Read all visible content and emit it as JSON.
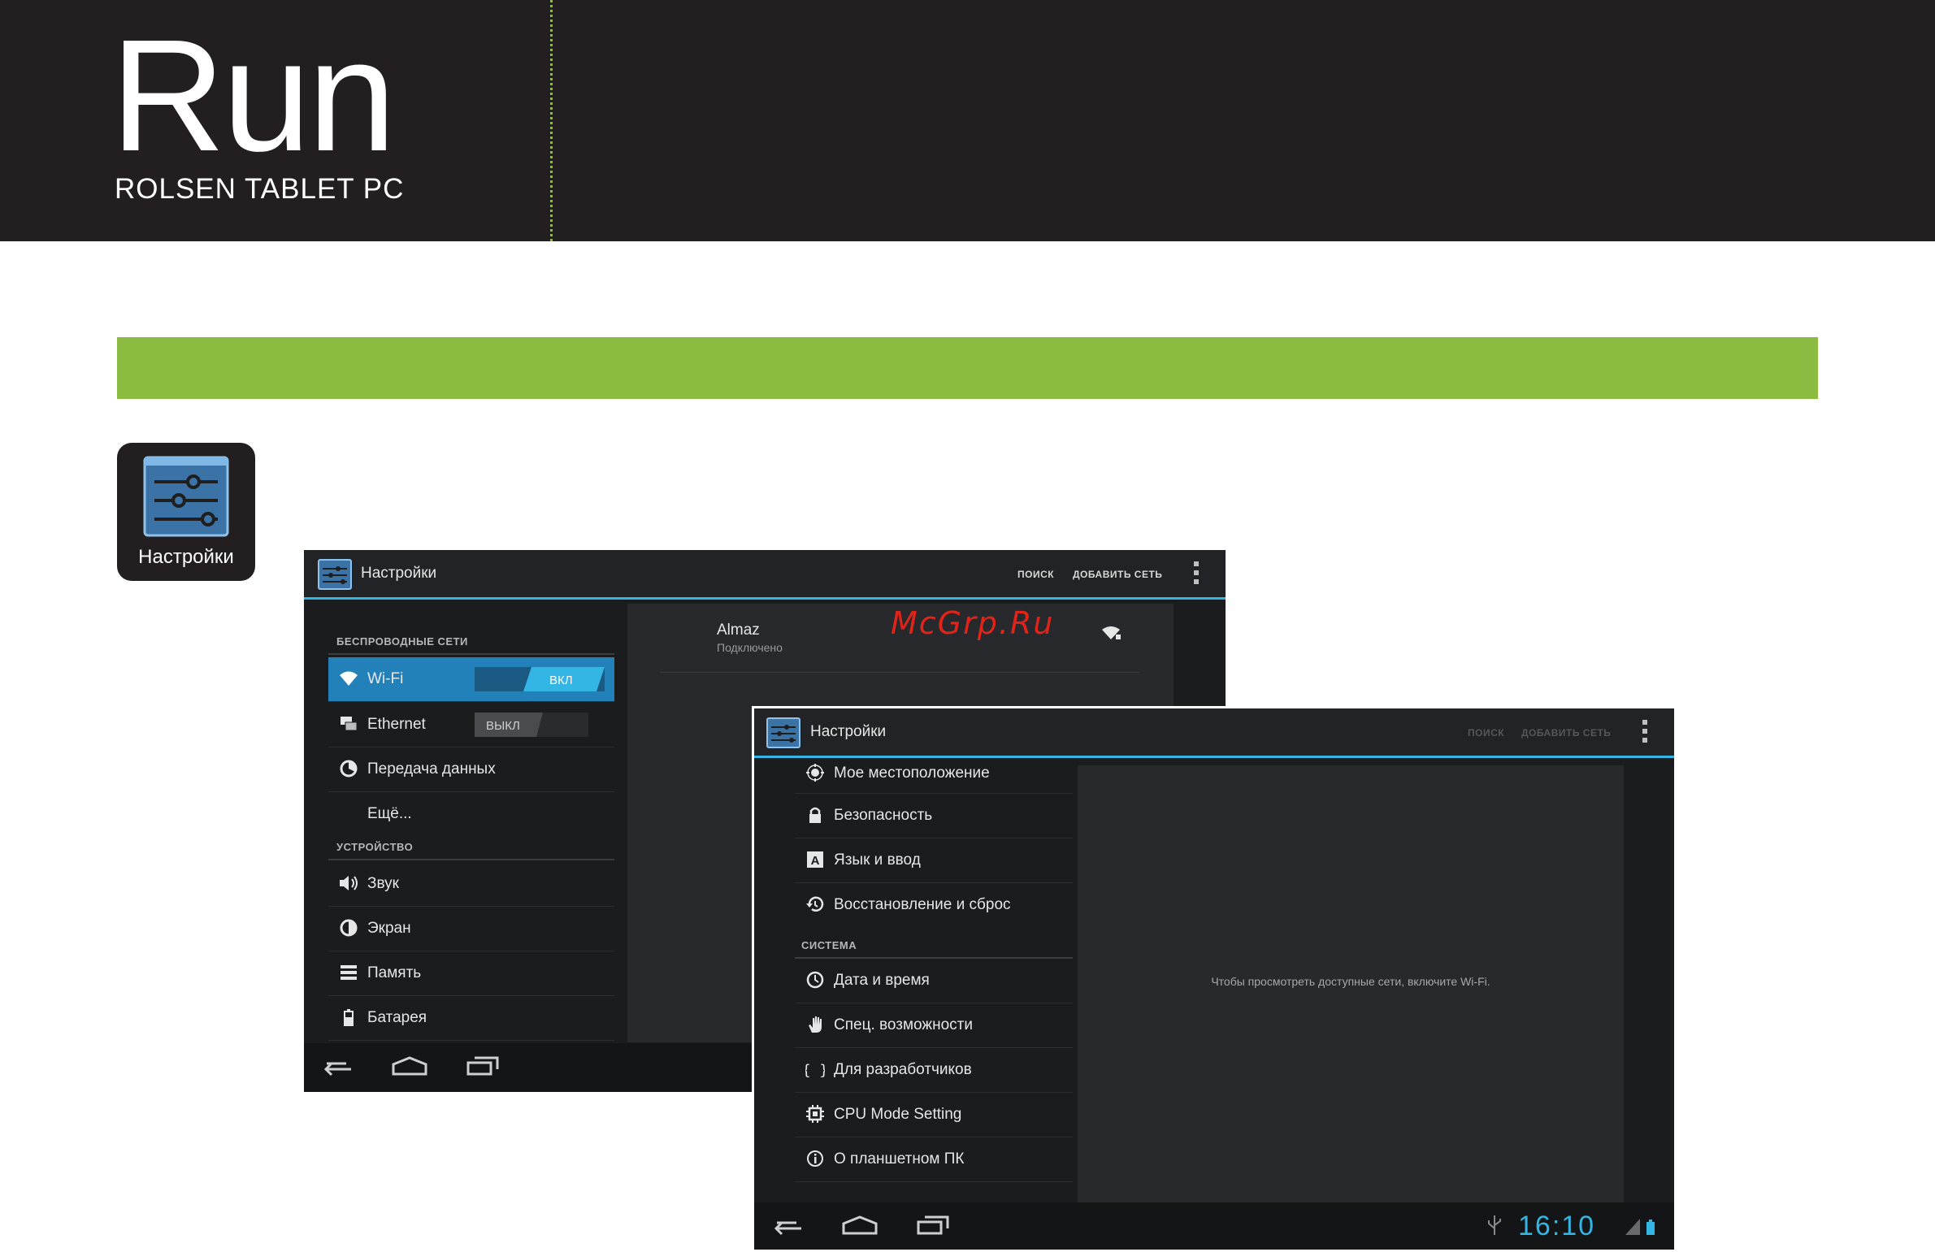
{
  "header": {
    "brand": "Run",
    "subtitle": "ROLSEN TABLET PC"
  },
  "app_icon": {
    "label": "Настройки",
    "icon": "settings-sliders-icon"
  },
  "screen1": {
    "title": "Настройки",
    "actions": [
      "ПОИСК",
      "ДОБАВИТЬ СЕТЬ"
    ],
    "sections": [
      "БЕСПРОВОДНЫЕ СЕТИ",
      "УСТРОЙСТВО"
    ],
    "items": [
      {
        "label": "Wi-Fi",
        "icon": "wifi-icon",
        "toggle": "ВКЛ"
      },
      {
        "label": "Ethernet",
        "icon": "ethernet-icon",
        "toggle": "ВЫКЛ"
      },
      {
        "label": "Передача данных",
        "icon": "data-usage-icon"
      },
      {
        "label": "Ещё..."
      },
      {
        "label": "Звук",
        "icon": "sound-icon"
      },
      {
        "label": "Экран",
        "icon": "display-icon"
      },
      {
        "label": "Память",
        "icon": "storage-icon"
      },
      {
        "label": "Батарея",
        "icon": "battery-icon"
      }
    ],
    "network": {
      "name": "Almaz",
      "status": "Подключено"
    },
    "watermark": "McGrp.Ru"
  },
  "screen2": {
    "title": "Настройки",
    "actions": [
      "ПОИСК",
      "ДОБАВИТЬ СЕТЬ"
    ],
    "section": "СИСТЕМА",
    "items": [
      {
        "label": "Мое местоположение",
        "icon": "location-icon"
      },
      {
        "label": "Безопасность",
        "icon": "lock-icon"
      },
      {
        "label": "Язык и ввод",
        "icon": "language-icon"
      },
      {
        "label": "Восстановление и сброс",
        "icon": "restore-icon"
      },
      {
        "label": "Дата и время",
        "icon": "clock-icon"
      },
      {
        "label": "Спец. возможности",
        "icon": "hand-icon"
      },
      {
        "label": "Для разработчиков",
        "icon": "braces-icon"
      },
      {
        "label": "CPU Mode Setting",
        "icon": "cpu-icon"
      },
      {
        "label": "О планшетном ПК",
        "icon": "info-icon"
      }
    ],
    "message": "Чтобы просмотреть доступные сети, включите Wi-Fi.",
    "time": "16:10"
  },
  "colors": {
    "topbar": "#231f20",
    "green": "#8cbb42",
    "holo_blue": "#33b5e5",
    "watermark": "#e2231a"
  }
}
